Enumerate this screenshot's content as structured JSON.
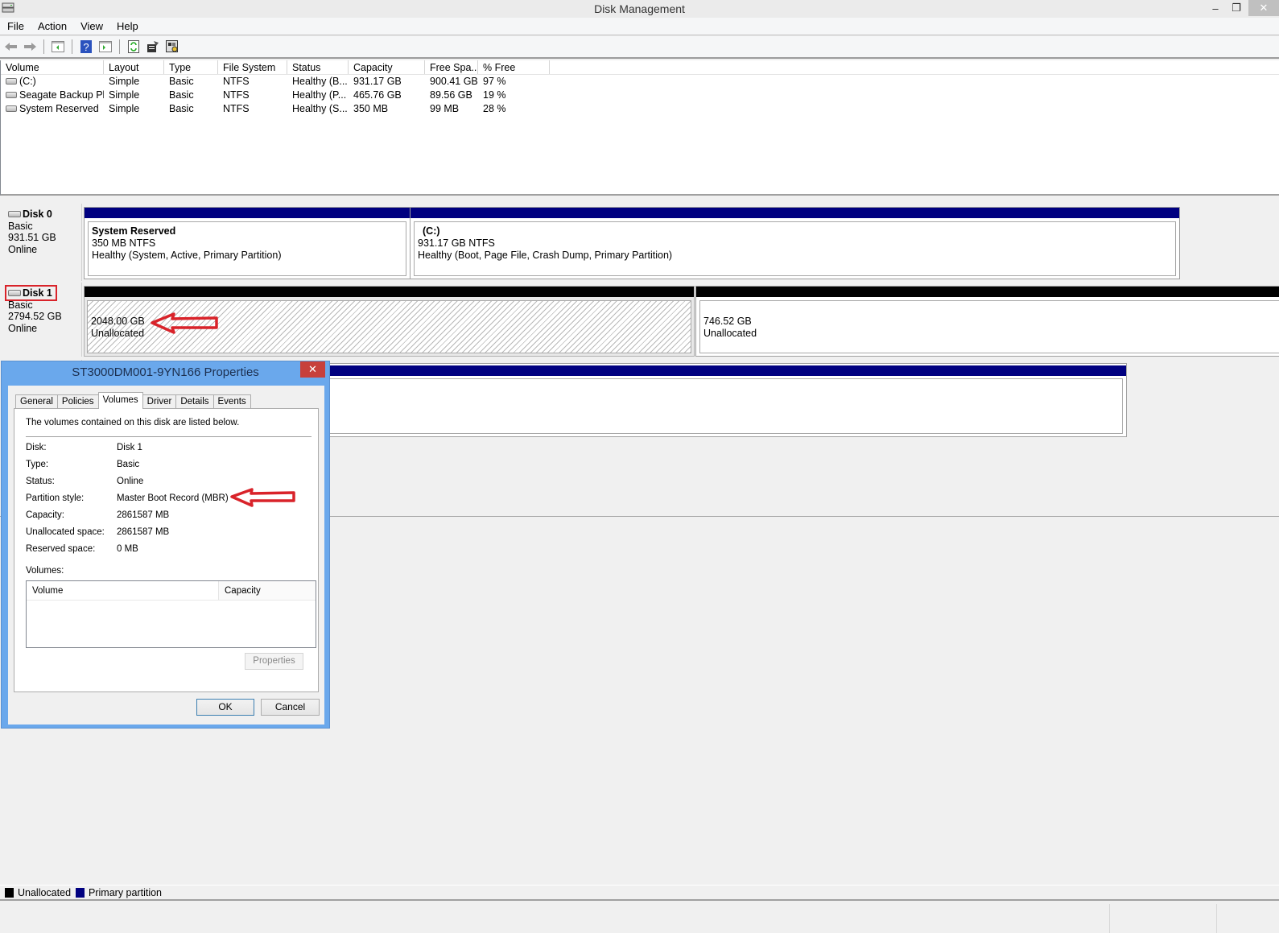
{
  "window": {
    "title": "Disk Management",
    "icon": "disk-management-icon",
    "controls": {
      "minimize": "–",
      "restore": "❐",
      "close": "✕"
    }
  },
  "menu": [
    "File",
    "Action",
    "View",
    "Help"
  ],
  "toolbar": {
    "buttons": [
      "back-icon",
      "forward-icon",
      "show-hide-console-tree-icon",
      "help-icon",
      "show-hide-action-pane-icon",
      "refresh-icon",
      "properties-icon",
      "settings-icon"
    ]
  },
  "volume_list": {
    "columns": [
      "Volume",
      "Layout",
      "Type",
      "File System",
      "Status",
      "Capacity",
      "Free Spa...",
      "% Free"
    ],
    "rows": [
      [
        "(C:)",
        "Simple",
        "Basic",
        "NTFS",
        "Healthy (B...",
        "931.17 GB",
        "900.41 GB",
        "97 %"
      ],
      [
        "Seagate Backup Pl...",
        "Simple",
        "Basic",
        "NTFS",
        "Healthy (P...",
        "465.76 GB",
        "89.56 GB",
        "19 %"
      ],
      [
        "System Reserved",
        "Simple",
        "Basic",
        "NTFS",
        "Healthy (S...",
        "350 MB",
        "99 MB",
        "28 %"
      ]
    ]
  },
  "disks": [
    {
      "name": "Disk 0",
      "type": "Basic",
      "size": "931.51 GB",
      "status": "Online",
      "partitions": [
        {
          "title": "System Reserved",
          "size": "350 MB NTFS",
          "status": "Healthy (System, Active, Primary Partition)"
        },
        {
          "title": "(C:)",
          "size": "931.17 GB NTFS",
          "status": "Healthy (Boot, Page File, Crash Dump, Primary Partition)"
        }
      ]
    },
    {
      "name": "Disk 1",
      "type": "Basic",
      "size": "2794.52 GB",
      "status": "Online",
      "partitions": [
        {
          "size": "2048.00 GB",
          "status": "Unallocated"
        },
        {
          "size": "746.52 GB",
          "status": "Unallocated"
        }
      ]
    }
  ],
  "legend": [
    {
      "label": "Unallocated",
      "color": "#000000"
    },
    {
      "label": "Primary partition",
      "color": "#000080"
    }
  ],
  "colors": {
    "primary_partition": "#000080",
    "unallocated": "#000000",
    "annotation": "#d9232a",
    "dialog_frame": "#6aa8ec"
  },
  "dialog": {
    "title": "ST3000DM001-9YN166 Properties",
    "close": "✕",
    "tabs": [
      "General",
      "Policies",
      "Volumes",
      "Driver",
      "Details",
      "Events"
    ],
    "active_tab": "Volumes",
    "intro": "The volumes contained on this disk are listed below.",
    "properties": [
      {
        "label": "Disk:",
        "value": "Disk 1"
      },
      {
        "label": "Type:",
        "value": "Basic"
      },
      {
        "label": "Status:",
        "value": "Online"
      },
      {
        "label": "Partition style:",
        "value": "Master Boot Record (MBR)"
      },
      {
        "label": "Capacity:",
        "value": "2861587 MB"
      },
      {
        "label": "Unallocated space:",
        "value": "2861587 MB"
      },
      {
        "label": "Reserved space:",
        "value": "0 MB"
      }
    ],
    "volumes_label": "Volumes:",
    "volumes_columns": [
      "Volume",
      "Capacity"
    ],
    "properties_button": "Properties",
    "ok": "OK",
    "cancel": "Cancel"
  }
}
